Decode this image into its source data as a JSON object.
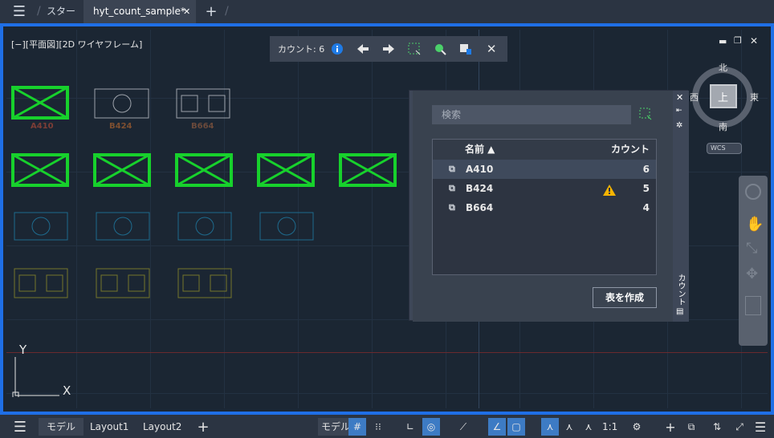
{
  "tabs": {
    "start": "スタート",
    "doc": "hyt_count_sample*"
  },
  "viewport": {
    "title": "[−][平面図][2D ワイヤフレーム]"
  },
  "count_toolbar": {
    "label": "カウント: 6"
  },
  "blocks": {
    "a": "A410",
    "b": "B424",
    "c": "B664"
  },
  "panel": {
    "search_placeholder": "検索",
    "col_name": "名前 ▲",
    "col_count": "カウント",
    "rows": [
      {
        "name": "A410",
        "count": "6"
      },
      {
        "name": "B424",
        "count": "5"
      },
      {
        "name": "B664",
        "count": "4"
      }
    ],
    "create_table": "表を作成",
    "side_title": "カウント"
  },
  "viewcube": {
    "north": "北",
    "south": "南",
    "east": "東",
    "west": "西",
    "top": "上",
    "wcs": "WCS"
  },
  "axis": {
    "y": "Y",
    "x": "X"
  },
  "status": {
    "model_tab": "モデル",
    "layout1": "Layout1",
    "layout2": "Layout2",
    "model_btn": "モデル",
    "scale": "1:1"
  },
  "colors": {
    "accent": "#1f6fe6",
    "green": "#17d12c",
    "warning": "#f5b400"
  }
}
